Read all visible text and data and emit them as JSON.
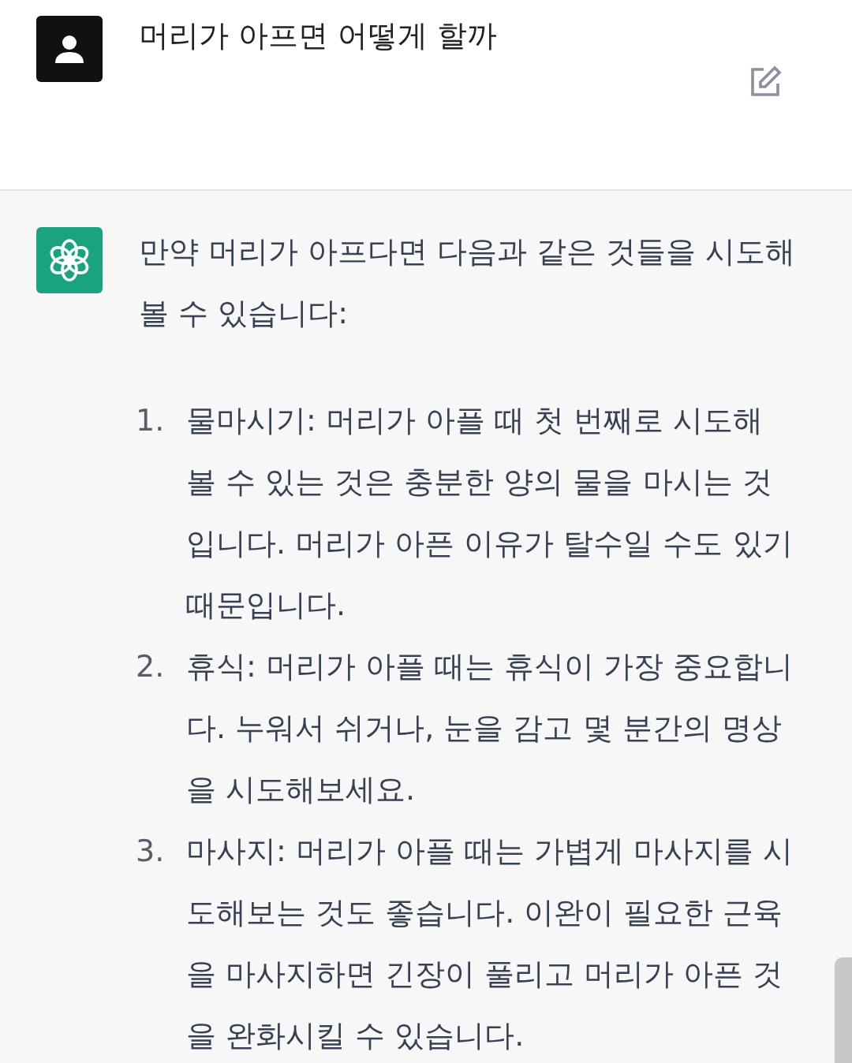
{
  "user_message": {
    "text": "머리가 아프면 어떻게 할까"
  },
  "assistant_message": {
    "intro": "만약 머리가 아프다면 다음과 같은 것들을 시도해 볼 수 있습니다:",
    "items": [
      {
        "number": "1.",
        "text": "물마시기: 머리가 아플 때 첫 번째로 시도해 볼 수 있는 것은 충분한 양의 물을 마시는 것입니다. 머리가 아픈 이유가 탈수일 수도 있기 때문입니다."
      },
      {
        "number": "2.",
        "text": "휴식: 머리가 아플 때는 휴식이 가장 중요합니다. 누워서 쉬거나, 눈을 감고 몇 분간의 명상을 시도해보세요."
      },
      {
        "number": "3.",
        "text": "마사지: 머리가 아플 때는 가볍게 마사지를 시도해보는 것도 좋습니다. 이완이 필요한 근육을 마사지하면 긴장이 풀리고 머리가 아픈 것을 완화시킬 수 있습니다."
      }
    ]
  }
}
